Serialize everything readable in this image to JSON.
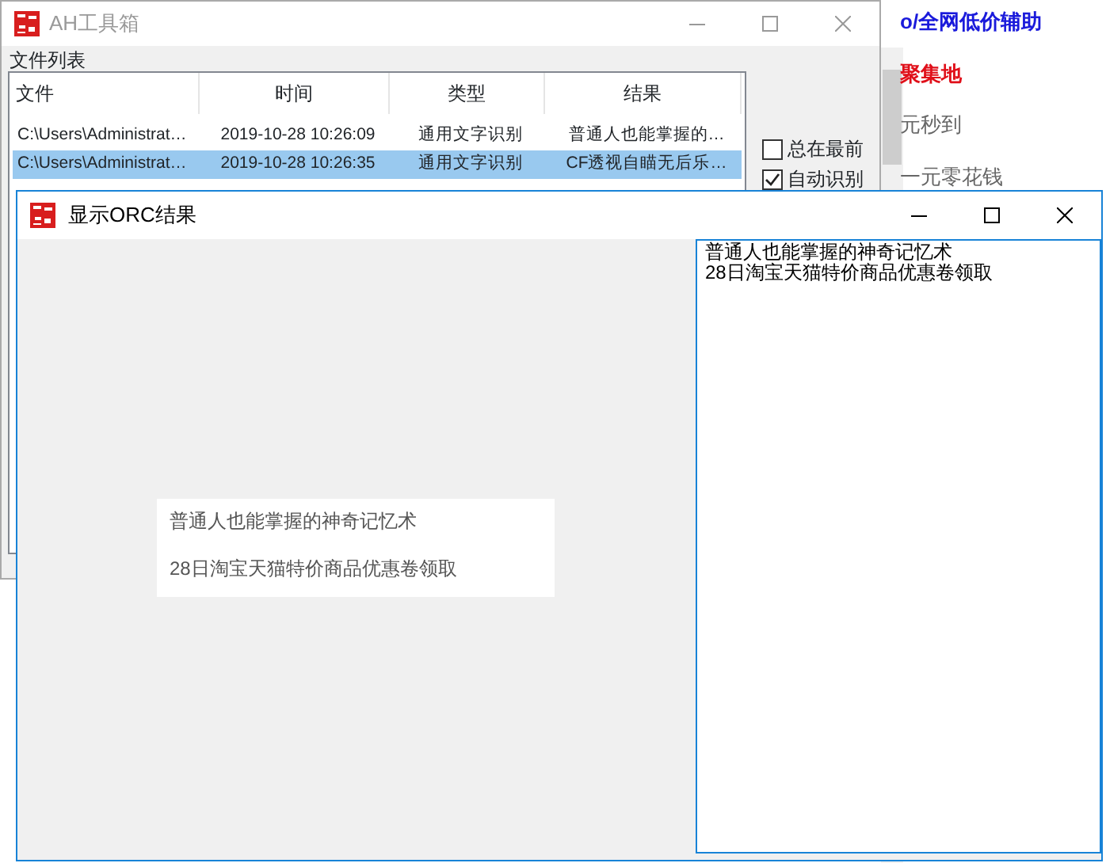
{
  "background_page": {
    "links": [
      {
        "text": "o/全网低价辅助",
        "kind": "blue"
      },
      {
        "text": "聚集地",
        "kind": "red"
      },
      {
        "text": "元秒到",
        "kind": "plain"
      },
      {
        "text": "一元零花钱",
        "kind": "plain"
      }
    ]
  },
  "main_window": {
    "title": "AH工具箱",
    "group_title": "文件列表",
    "table": {
      "columns": [
        "文件",
        "时间",
        "类型",
        "结果"
      ],
      "rows": [
        {
          "cells": [
            "C:\\Users\\Administrat…",
            "2019-10-28 10:26:09",
            "通用文字识别",
            "普通人也能掌握的…"
          ],
          "selected": false
        },
        {
          "cells": [
            "C:\\Users\\Administrat…",
            "2019-10-28 10:26:35",
            "通用文字识别",
            "CF透视自瞄无后乐…"
          ],
          "selected": true
        }
      ]
    },
    "checkboxes": [
      {
        "label": "总在最前",
        "checked": false
      },
      {
        "label": "自动识别",
        "checked": true
      }
    ]
  },
  "result_window": {
    "title": "显示ORC结果",
    "image_lines": [
      "普通人也能掌握的神奇记忆术",
      "28日淘宝天猫特价商品优惠卷领取"
    ],
    "text_lines": [
      "普通人也能掌握的神奇记忆术",
      "28日淘宝天猫特价商品优惠卷领取"
    ]
  }
}
